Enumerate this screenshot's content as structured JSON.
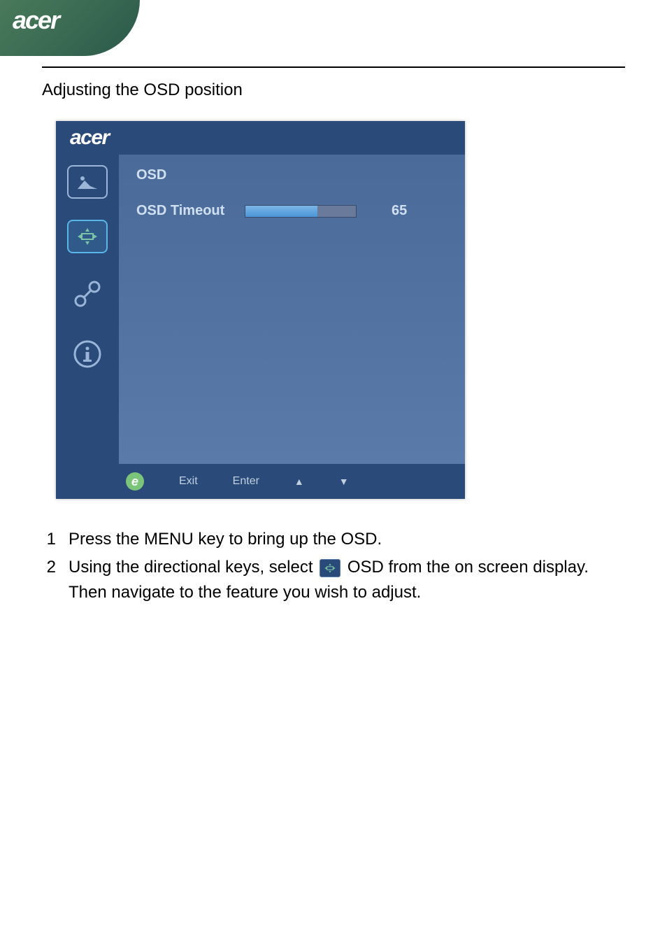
{
  "brand": "acer",
  "section_title": "Adjusting the OSD position",
  "osd": {
    "brand": "acer",
    "section_label": "OSD",
    "setting_label": "OSD Timeout",
    "setting_value": "65",
    "slider_percent": 65,
    "footer": {
      "exit": "Exit",
      "enter": "Enter"
    }
  },
  "steps": [
    {
      "num": "1",
      "text_before": "Press the MENU key to bring up the OSD.",
      "text_after": ""
    },
    {
      "num": "2",
      "text_before": "Using the directional keys, select ",
      "icon": true,
      "text_after": " OSD from the on screen display. Then navigate to the feature you wish to adjust."
    }
  ]
}
